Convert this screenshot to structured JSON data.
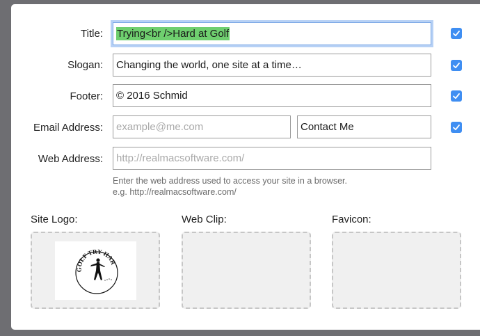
{
  "form": {
    "title": {
      "label": "Title:",
      "value": "Trying<br />Hard at Golf",
      "checked": true
    },
    "slogan": {
      "label": "Slogan:",
      "value": "Changing the world, one site at a time…",
      "checked": true
    },
    "footer": {
      "label": "Footer:",
      "value": "© 2016 Schmid",
      "checked": true
    },
    "email": {
      "label": "Email Address:",
      "placeholder": "example@me.com",
      "contact_value": "Contact Me",
      "checked": true
    },
    "web": {
      "label": "Web Address:",
      "placeholder": "http://realmacsoftware.com/",
      "hint_line1": "Enter the web address used to access your site in a browser.",
      "hint_line2": "e.g. http://realmacsoftware.com/"
    }
  },
  "images": {
    "site_logo": {
      "label": "Site Logo:",
      "logo_text": "GOLF TRY HARD"
    },
    "web_clip": {
      "label": "Web Clip:"
    },
    "favicon": {
      "label": "Favicon:"
    }
  },
  "colors": {
    "checkbox": "#3f8ef2",
    "selection": "#6fcf6f",
    "focus_ring": "#b7d1f5"
  }
}
